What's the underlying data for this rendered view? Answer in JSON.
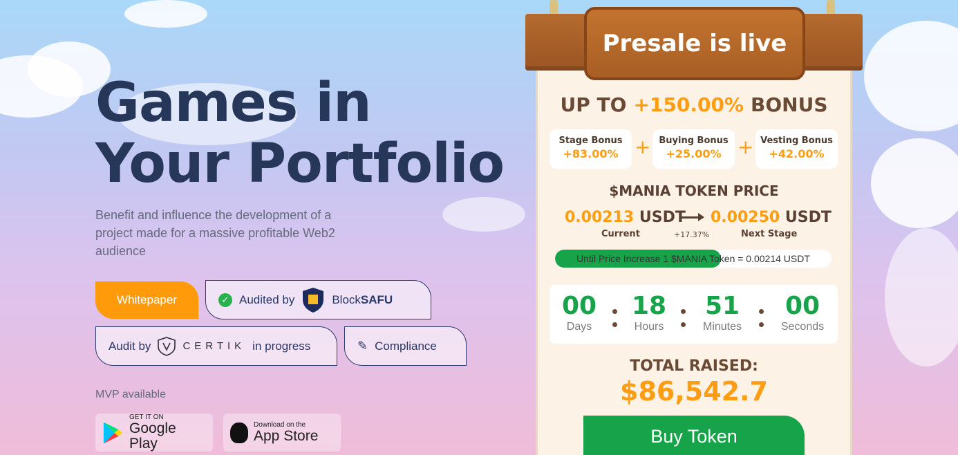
{
  "hero": {
    "title": "Games in Your Portfolio",
    "subtitle": "Benefit and influence the development of a project made for a massive profitable Web2 audience"
  },
  "badges": {
    "whitepaper": "Whitepaper",
    "audited_by": "Audited by",
    "audited_brand_a": "Block",
    "audited_brand_b": "SAFU",
    "audit_by": "Audit by",
    "certik": "CERTIK",
    "in_progress": "in progress",
    "compliance": "Compliance"
  },
  "mvp": "MVP available",
  "stores": {
    "google_small": "GET IT ON",
    "google_big": "Google Play",
    "apple_small": "Download on the",
    "apple_big": "App Store"
  },
  "presale": {
    "sign": "Presale is live",
    "bonus_prefix": "UP TO",
    "bonus_value": "+150.00%",
    "bonus_suffix": "BONUS",
    "bonuses": [
      {
        "label": "Stage Bonus",
        "value": "+83.00%"
      },
      {
        "label": "Buying Bonus",
        "value": "+25.00%"
      },
      {
        "label": "Vesting Bonus",
        "value": "+42.00%"
      }
    ],
    "price_title": "$MANIA TOKEN PRICE",
    "current_price": "0.00213",
    "next_price": "0.00250",
    "currency": "USDT",
    "current_label": "Current",
    "next_label": "Next Stage",
    "increase": "+17.37%",
    "progress_text": "Until Price Increase 1 $MANIA Token = 0.00214 USDT",
    "progress_fraction": 0.6,
    "countdown": [
      {
        "value": "00",
        "unit": "Days"
      },
      {
        "value": "18",
        "unit": "Hours"
      },
      {
        "value": "51",
        "unit": "Minutes"
      },
      {
        "value": "00",
        "unit": "Seconds"
      }
    ],
    "raised_label": "TOTAL RAISED:",
    "raised_value": "$86,542.7",
    "buy_label": "Buy Token"
  },
  "colors": {
    "accent": "#ff9d12",
    "green": "#16a34a",
    "navy": "#263759"
  }
}
